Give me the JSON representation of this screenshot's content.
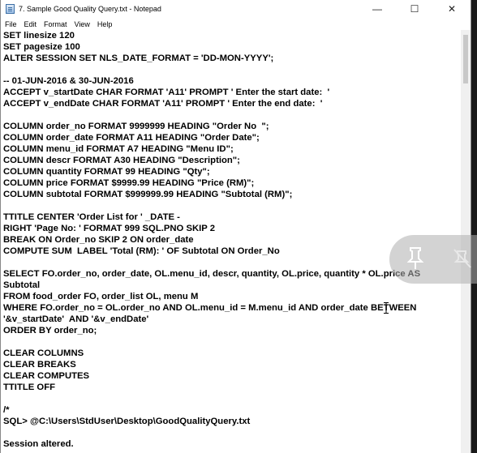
{
  "window": {
    "title": "7. Sample Good Quality Query.txt - Notepad",
    "controls": {
      "minimize": "—",
      "maximize": "☐",
      "close": "✕"
    }
  },
  "menu": [
    "File",
    "Edit",
    "Format",
    "View",
    "Help"
  ],
  "editor": {
    "lines": [
      "SET linesize 120",
      "SET pagesize 100",
      "ALTER SESSION SET NLS_DATE_FORMAT = 'DD-MON-YYYY';",
      "",
      "-- 01-JUN-2016 & 30-JUN-2016",
      "ACCEPT v_startDate CHAR FORMAT 'A11' PROMPT ' Enter the start date:  '",
      "ACCEPT v_endDate CHAR FORMAT 'A11' PROMPT ' Enter the end date:  '",
      "",
      "COLUMN order_no FORMAT 9999999 HEADING \"Order No  \";",
      "COLUMN order_date FORMAT A11 HEADING \"Order Date\";",
      "COLUMN menu_id FORMAT A7 HEADING \"Menu ID\";",
      "COLUMN descr FORMAT A30 HEADING \"Description\";",
      "COLUMN quantity FORMAT 99 HEADING \"Qty\";",
      "COLUMN price FORMAT $9999.99 HEADING \"Price (RM)\";",
      "COLUMN subtotal FORMAT $999999.99 HEADING \"Subtotal (RM)\";",
      "",
      "TTITLE CENTER 'Order List for ' _DATE -",
      "RIGHT 'Page No: ' FORMAT 999 SQL.PNO SKIP 2",
      "BREAK ON Order_no SKIP 2 ON order_date",
      "COMPUTE SUM  LABEL 'Total (RM): ' OF Subtotal ON Order_No",
      "",
      "SELECT FO.order_no, order_date, OL.menu_id, descr, quantity, OL.price, quantity * OL.price AS",
      "Subtotal",
      "FROM food_order FO, order_list OL, menu M",
      "WHERE FO.order_no = OL.order_no AND OL.menu_id = M.menu_id AND order_date BETWEEN",
      "'&v_startDate'  AND '&v_endDate'",
      "ORDER BY order_no;",
      "",
      "CLEAR COLUMNS",
      "CLEAR BREAKS",
      "CLEAR COMPUTES",
      "TTITLE OFF",
      "",
      "/*",
      "SQL> @C:\\Users\\StdUser\\Desktop\\GoodQualityQuery.txt",
      "",
      "Session altered."
    ]
  },
  "icons": {
    "app": "notepad-icon",
    "pin": "pin-icon",
    "unpin": "unpin-icon",
    "cursor": "text-cursor-icon"
  }
}
